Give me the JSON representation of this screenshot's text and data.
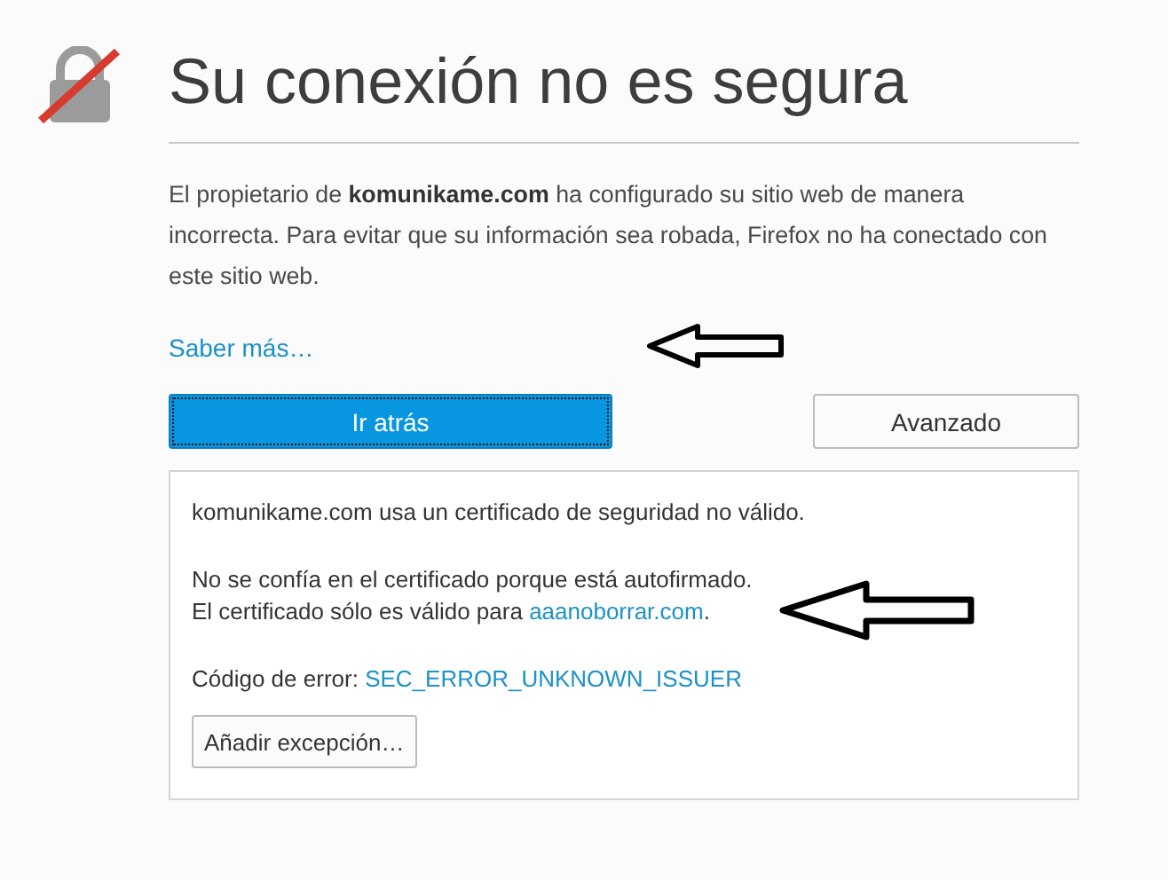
{
  "title": "Su conexión no es segura",
  "intro": "El propietario de **komunikame.com** ha configurado su sitio web de manera incorrecta. Para evitar que su información sea robada, Firefox no ha conectado con este sitio web.",
  "learn_more": "Saber más…",
  "buttons": [
    {
      "label": "Ir atrás",
      "kind": "primary",
      "focused": true
    },
    {
      "label": "Avanzado",
      "kind": "secondary",
      "focused": false
    }
  ],
  "advanced_panel": {
    "summary": "komunikame.com usa un certificado de seguridad no válido.",
    "reason": "No se confía en el certificado porque está autofirmado.",
    "valid_for_text": "El certificado sólo es válido para",
    "valid_for_domain": "aaanoborrar.com",
    "valid_for_end": ".",
    "error_label": "Código de error:",
    "error_code": "SEC_ERROR_UNKNOWN_ISSUER",
    "exception_button": "Añadir excepción…"
  }
}
